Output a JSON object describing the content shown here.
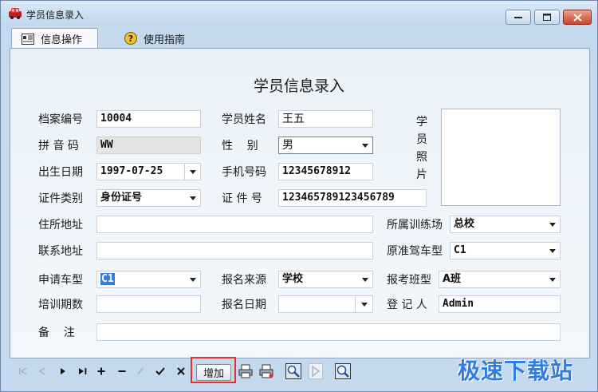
{
  "window": {
    "title": "学员信息录入"
  },
  "tabs": [
    {
      "label": "信息操作",
      "icon": "info-card-icon",
      "active": true
    },
    {
      "label": "使用指南",
      "icon": "help-icon",
      "active": false
    }
  ],
  "form": {
    "title": "学员信息录入",
    "archive_no": {
      "label": "档案编号",
      "value": "10004"
    },
    "student_name": {
      "label": "学员姓名",
      "value": "王五"
    },
    "pinyin": {
      "label": "拼 音 码",
      "value": "WW"
    },
    "gender": {
      "label": "性    别",
      "value": "男"
    },
    "birth_date": {
      "label": "出生日期",
      "value": "1997-07-25"
    },
    "phone": {
      "label": "手机号码",
      "value": "12345678912"
    },
    "id_type": {
      "label": "证件类别",
      "value": "身份证号"
    },
    "id_number": {
      "label": "证 件 号",
      "value": "123465789123456789"
    },
    "photo": {
      "label": "学员照片",
      "chars": [
        "学",
        "员",
        "照",
        "片"
      ]
    },
    "address": {
      "label": "住所地址",
      "value": ""
    },
    "training_school": {
      "label": "所属训练场",
      "value": "总校"
    },
    "contact_address": {
      "label": "联系地址",
      "value": ""
    },
    "original_license": {
      "label": "原准驾车型",
      "value": "C1"
    },
    "apply_type": {
      "label": "申请车型",
      "value": "C1"
    },
    "source": {
      "label": "报名来源",
      "value": "学校"
    },
    "class_type": {
      "label": "报考班型",
      "value": "A班"
    },
    "training_period": {
      "label": "培训期数",
      "value": ""
    },
    "signup_date": {
      "label": "报名日期",
      "value": ""
    },
    "registrar": {
      "label": "登 记 人",
      "value": "Admin"
    },
    "remarks": {
      "label": "备    注",
      "value": ""
    }
  },
  "toolbar": {
    "add_label": "增加",
    "nav": [
      "|◀",
      "◀",
      "▶",
      "▶|",
      "+",
      "−",
      "⁄",
      "✓",
      "✕"
    ]
  },
  "watermark": "极速下载站",
  "colors": {
    "highlight": "#e0312e",
    "watermark": "#2f7de0",
    "window_bg": "#c4d9ee"
  }
}
